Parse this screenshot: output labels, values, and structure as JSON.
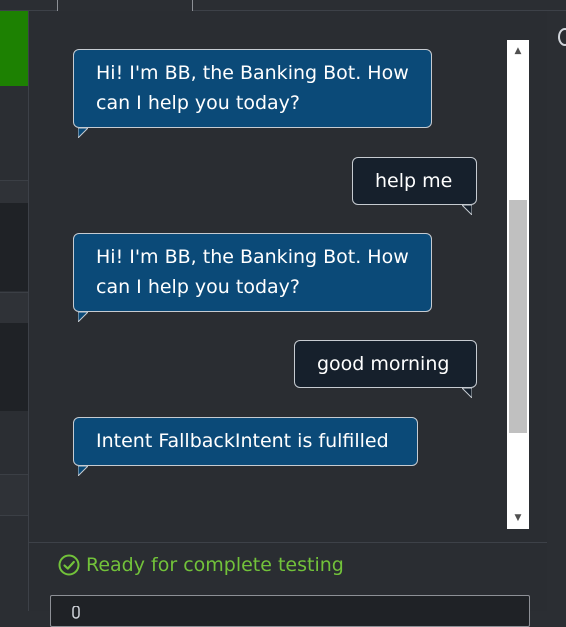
{
  "chat": {
    "messages": [
      {
        "sender": "bot",
        "text": "Hi! I'm BB, the Banking Bot. How can I help you today?"
      },
      {
        "sender": "user",
        "text": "help me"
      },
      {
        "sender": "bot",
        "text": "Hi! I'm BB, the Banking Bot. How can I help you today?"
      },
      {
        "sender": "user",
        "text": "good morning"
      },
      {
        "sender": "bot",
        "text": "Intent FallbackIntent is fulfilled"
      }
    ]
  },
  "status": {
    "text": "Ready for complete testing",
    "icon": "check-circle-icon",
    "color": "#72c23a"
  },
  "colors": {
    "bot_bubble": "#0b4a78",
    "user_bubble": "#16202c",
    "panel_bg": "#2a2d32",
    "accent_green": "#1d8102"
  }
}
